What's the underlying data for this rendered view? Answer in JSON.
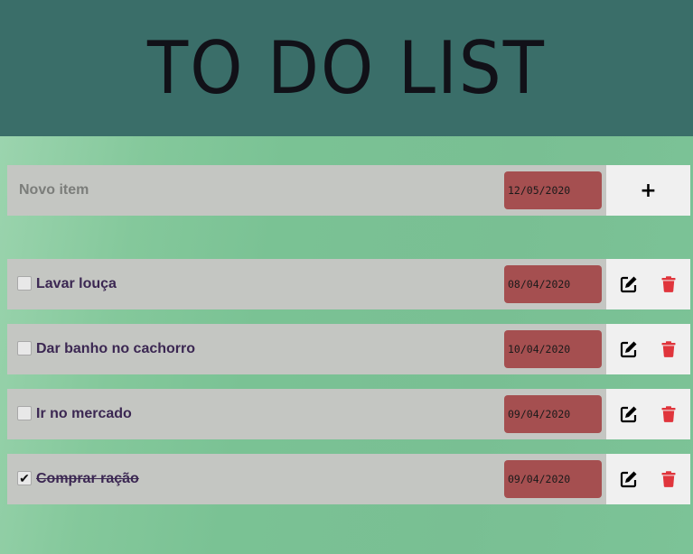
{
  "header": {
    "title": "TO DO LIST"
  },
  "new_item": {
    "placeholder": "Novo item",
    "date": "12/05/2020",
    "add_label": "+"
  },
  "items": [
    {
      "label": "Lavar louça",
      "date": "08/04/2020",
      "done": false
    },
    {
      "label": "Dar banho no cachorro",
      "date": "10/04/2020",
      "done": false
    },
    {
      "label": "Ir no mercado",
      "date": "09/04/2020",
      "done": false
    },
    {
      "label": "Comprar ração",
      "date": "09/04/2020",
      "done": true
    }
  ],
  "check_mark": "✔",
  "icons": {
    "edit": "edit-icon",
    "delete": "trash-icon"
  },
  "colors": {
    "header_bg": "#3a6e69",
    "date_bg": "#a54f50",
    "delete_icon": "#e0353c",
    "item_text": "#3b2752"
  }
}
